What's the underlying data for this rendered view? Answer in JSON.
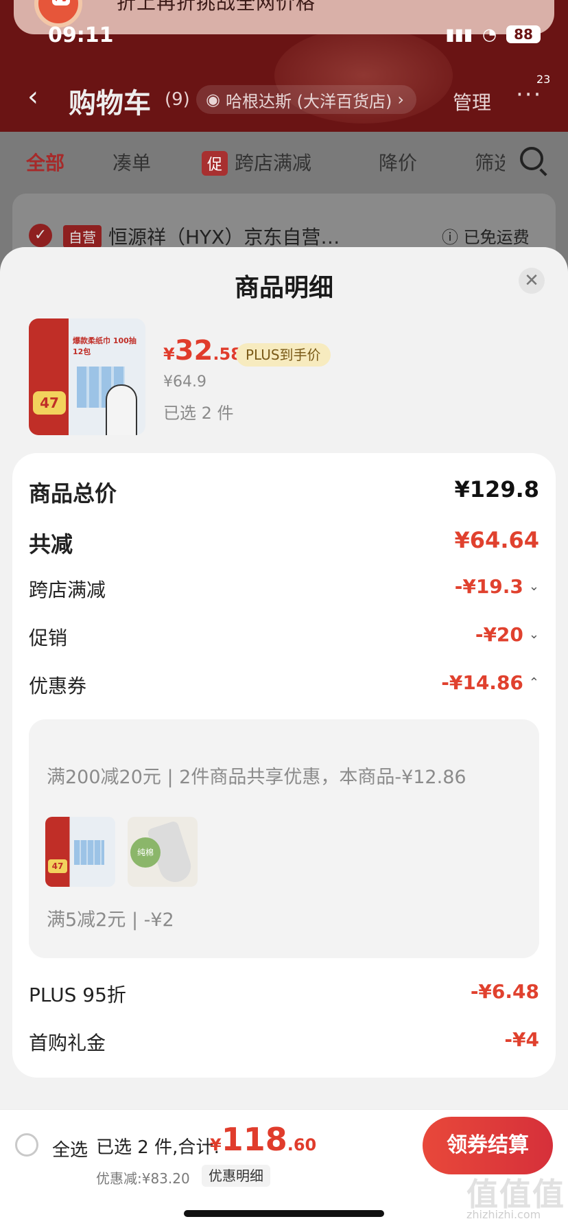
{
  "banner": {
    "text": "折上再折挑战全网价格",
    "logo_text": "淘"
  },
  "status_bar": {
    "time": "09:11",
    "battery": "88"
  },
  "nav": {
    "back_icon": "chevron-left-icon",
    "title": "购物车",
    "count": "(9)",
    "address": "哈根达斯 (大洋百货店)",
    "manage": "管理",
    "more": "···",
    "badge": "23"
  },
  "filter_tabs": [
    {
      "label": "全部"
    },
    {
      "label": "凑单"
    },
    {
      "label": "跨店满减",
      "chip": "促"
    },
    {
      "label": "降价"
    },
    {
      "label": "筛选"
    }
  ],
  "store_row": {
    "tag": "自营",
    "name": "恒源祥（HYX）京东自营…",
    "freeship": "已免运费"
  },
  "sheet": {
    "title": "商品明细",
    "close_icon": "close-icon",
    "product": {
      "thumb_badge": "47",
      "thumb_title": "爆款柔纸巾 100抽12包",
      "price_yen": "¥",
      "price_int": "32",
      "price_dec": ".58",
      "plus_tag": "PLUS到手价",
      "original_price": "¥64.9",
      "selected": "已选 2 件"
    },
    "detail": {
      "total_label": "商品总价",
      "total_value": "¥129.8",
      "reduce_label": "共减",
      "reduce_value": "¥64.64",
      "cross_store_label": "跨店满减",
      "cross_store_value": "-¥19.3",
      "promo_label": "促销",
      "promo_value": "-¥20",
      "coupon_label": "优惠券",
      "coupon_value": "-¥14.86",
      "coupon_desc": "满200减20元 | 2件商品共享优惠，本商品-¥12.86",
      "coupon_thumb1_badge": "47",
      "coupon_thumb2_label": "纯棉",
      "coupon_sub": "满5减2元 | -¥2",
      "plus_label": "PLUS 95折",
      "plus_value": "-¥6.48",
      "firstbuy_label": "首购礼金",
      "firstbuy_value": "-¥4"
    }
  },
  "bottom_bar": {
    "select_all": "全选",
    "total_label": "已选 2 件,合计:",
    "total_yen": "¥",
    "total_int": "118",
    "total_dec": ".60",
    "discount_text": "优惠减:¥83.20",
    "discount_btn": "优惠明细",
    "checkout": "领券结算"
  },
  "watermark": {
    "text": "值值值",
    "url": "zhizhizhi.com"
  },
  "colors": {
    "accent": "#e03c2c",
    "header_bg": "#6a1414",
    "checkout_gradient_start": "#e8483a"
  }
}
